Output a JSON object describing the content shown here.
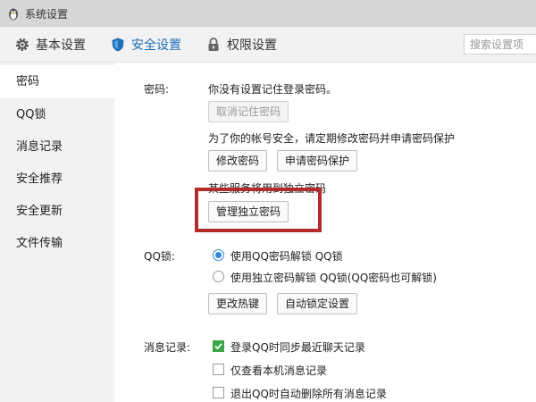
{
  "window": {
    "title": "系统设置"
  },
  "tabs": [
    {
      "label": "基本设置",
      "icon": "gear-icon"
    },
    {
      "label": "安全设置",
      "icon": "shield-icon",
      "active": true
    },
    {
      "label": "权限设置",
      "icon": "lock-icon"
    }
  ],
  "search": {
    "placeholder": "搜索设置项"
  },
  "sidebar": {
    "items": [
      {
        "label": "密码",
        "active": true
      },
      {
        "label": "QQ锁"
      },
      {
        "label": "消息记录"
      },
      {
        "label": "安全推荐"
      },
      {
        "label": "安全更新"
      },
      {
        "label": "文件传输"
      }
    ]
  },
  "password": {
    "section_label": "密码:",
    "status_text": "你没有设置记住登录密码。",
    "cancel_remember_button": "取消记住密码",
    "advice_text": "为了你的帐号安全，请定期修改密码并申请密码保护",
    "change_password_button": "修改密码",
    "apply_protection_button": "申请密码保护",
    "independent_text": "某些服务将用到独立密码",
    "manage_independent_button": "管理独立密码"
  },
  "qqlock": {
    "section_label": "QQ锁:",
    "option_qq_password": "使用QQ密码解锁 QQ锁",
    "option_independent": "使用独立密码解锁 QQ锁(QQ密码也可解锁)",
    "selected": "option_qq_password",
    "change_hotkey_button": "更改热键",
    "auto_lock_button": "自动锁定设置"
  },
  "messages": {
    "section_label": "消息记录:",
    "option_sync": {
      "label": "登录QQ时同步最近聊天记录",
      "checked": true
    },
    "option_local_only": {
      "label": "仅查看本机消息记录",
      "checked": false
    },
    "option_delete_on_exit": {
      "label": "退出QQ时自动删除所有消息记录",
      "checked": false
    }
  },
  "colors": {
    "accent": "#1b6fb8",
    "radio_selected": "#2f88d8",
    "checkbox_checked": "#3aa548",
    "highlight_box": "#b52a2a"
  }
}
